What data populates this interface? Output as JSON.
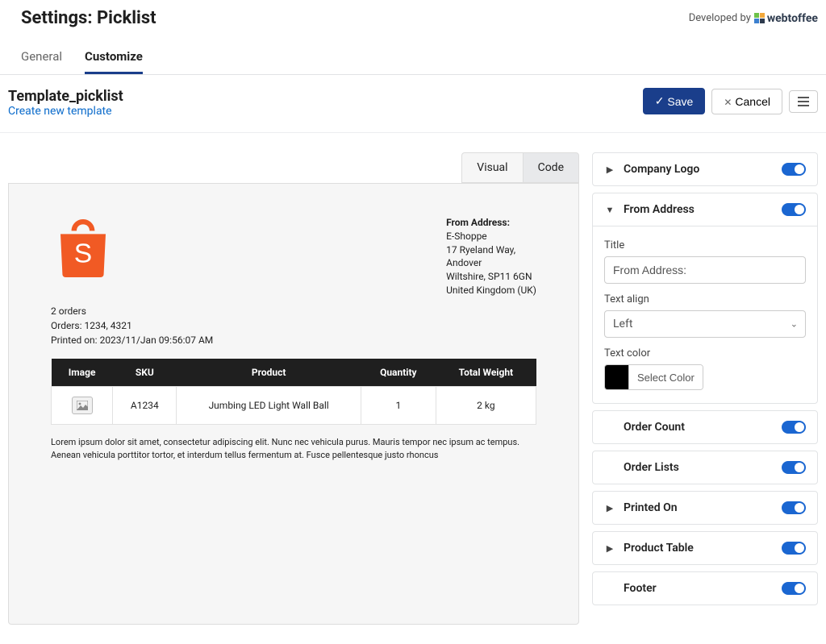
{
  "header": {
    "title": "Settings: Picklist",
    "developed_by": "Developed by",
    "brand": "webtoffee"
  },
  "nav_tabs": {
    "general": "General",
    "customize": "Customize"
  },
  "template": {
    "name": "Template_picklist",
    "create_link": "Create new template"
  },
  "actions": {
    "save": "Save",
    "cancel": "Cancel"
  },
  "view_tabs": {
    "visual": "Visual",
    "code": "Code"
  },
  "preview": {
    "from_title": "From Address:",
    "from_lines": [
      "E-Shoppe",
      "17 Ryeland Way,",
      "Andover",
      "Wiltshire, SP11 6GN",
      "United Kingdom (UK)"
    ],
    "order_count": "2 orders",
    "orders_line": "Orders: 1234, 4321",
    "printed_on": "Printed on: 2023/11/Jan 09:56:07 AM",
    "columns": [
      "Image",
      "SKU",
      "Product",
      "Quantity",
      "Total Weight"
    ],
    "rows": [
      {
        "sku": "A1234",
        "product": "Jumbing LED Light Wall Ball",
        "qty": "1",
        "weight": "2 kg"
      }
    ],
    "footer": "Lorem ipsum dolor sit amet, consectetur adipiscing elit. Nunc nec vehicula purus. Mauris tempor nec ipsum ac tempus. Aenean vehicula porttitor tortor, et interdum tellus fermentum at. Fusce pellentesque justo rhoncus"
  },
  "sidepanel": {
    "items": {
      "company_logo": "Company Logo",
      "from_address": "From Address",
      "order_count": "Order Count",
      "order_lists": "Order Lists",
      "printed_on": "Printed On",
      "product_table": "Product Table",
      "footer": "Footer"
    },
    "from_fields": {
      "title_label": "Title",
      "title_value": "From Address:",
      "text_align_label": "Text align",
      "text_align_value": "Left",
      "text_color_label": "Text color",
      "select_color": "Select Color",
      "color_value": "#000000"
    }
  }
}
